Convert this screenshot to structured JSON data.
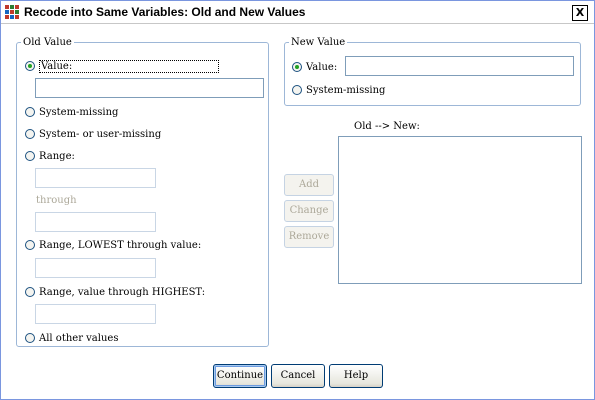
{
  "window": {
    "title": "Recode into Same Variables: Old and New Values",
    "close_label": "X"
  },
  "old_value": {
    "legend": "Old Value",
    "value_label": "Value:",
    "value_input": "",
    "system_missing_label": "System-missing",
    "system_or_user_missing_label": "System- or user-missing",
    "range_label": "Range:",
    "range_from": "",
    "through_label": "through",
    "range_to": "",
    "range_lowest_label": "Range, LOWEST through value:",
    "range_lowest_input": "",
    "range_highest_label": "Range, value through HIGHEST:",
    "range_highest_input": "",
    "all_other_label": "All other values",
    "selected": "value"
  },
  "new_value": {
    "legend": "New Value",
    "value_label": "Value:",
    "value_input": "",
    "system_missing_label": "System-missing",
    "selected": "value"
  },
  "mapping": {
    "list_label": "Old --> New:",
    "items": []
  },
  "buttons": {
    "add": "Add",
    "change": "Change",
    "remove": "Remove",
    "continue": "Continue",
    "cancel": "Cancel",
    "help": "Help"
  },
  "colors": {
    "title_bar": "#ffffff",
    "window_border": "#7a96df",
    "radio_checked": "#21a121",
    "button_border": "#003c74"
  }
}
